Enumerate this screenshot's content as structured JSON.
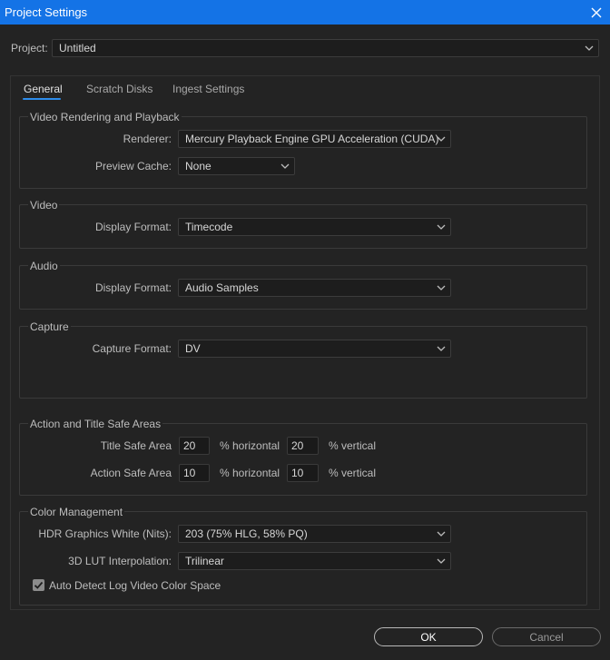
{
  "window": {
    "title": "Project Settings"
  },
  "project": {
    "label": "Project:",
    "value": "Untitled"
  },
  "tabs": [
    {
      "label": "General"
    },
    {
      "label": "Scratch Disks"
    },
    {
      "label": "Ingest Settings"
    }
  ],
  "video_rendering": {
    "title": "Video Rendering and Playback",
    "renderer_label": "Renderer:",
    "renderer_value": "Mercury Playback Engine GPU Acceleration (CUDA)",
    "preview_cache_label": "Preview Cache:",
    "preview_cache_value": "None"
  },
  "video": {
    "title": "Video",
    "display_format_label": "Display Format:",
    "display_format_value": "Timecode"
  },
  "audio": {
    "title": "Audio",
    "display_format_label": "Display Format:",
    "display_format_value": "Audio Samples"
  },
  "capture": {
    "title": "Capture",
    "capture_format_label": "Capture Format:",
    "capture_format_value": "DV"
  },
  "safe_areas": {
    "title": "Action and Title Safe Areas",
    "title_safe_label": "Title Safe Area",
    "title_safe_h": "20",
    "title_safe_v": "20",
    "action_safe_label": "Action Safe Area",
    "action_safe_h": "10",
    "action_safe_v": "10",
    "horizontal_unit": "% horizontal",
    "vertical_unit": "% vertical"
  },
  "color_management": {
    "title": "Color Management",
    "hdr_label": "HDR Graphics White (Nits):",
    "hdr_value": "203 (75% HLG, 58% PQ)",
    "lut_label": "3D LUT Interpolation:",
    "lut_value": "Trilinear",
    "auto_detect_label": "Auto Detect Log Video Color Space",
    "auto_detect_checked": true
  },
  "buttons": {
    "ok": "OK",
    "cancel": "Cancel"
  },
  "colors": {
    "titlebar": "#1473e6",
    "accent": "#2d8ceb",
    "background": "#232323"
  },
  "icons": {
    "close": "close-icon",
    "dropdown": "chevron-down-icon",
    "check": "checkmark-icon"
  }
}
